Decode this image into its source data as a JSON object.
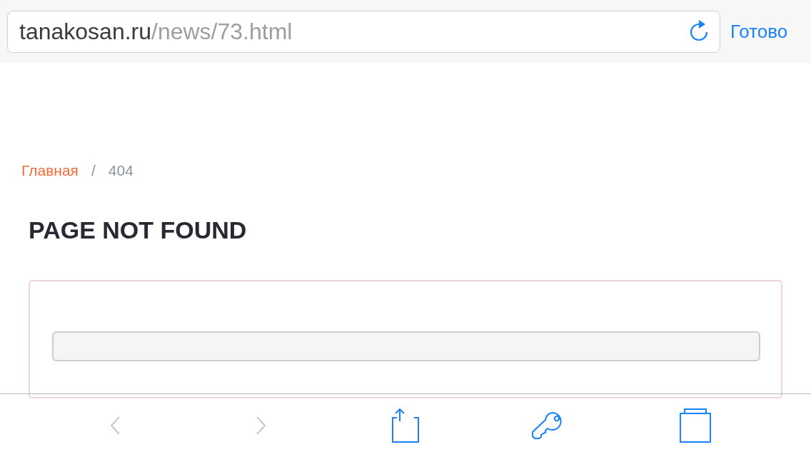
{
  "address_bar": {
    "host": "tanakosan.ru",
    "path": "/news/73.html",
    "done_label": "Готово"
  },
  "breadcrumb": [
    {
      "label": "Главная",
      "kind": "link"
    },
    {
      "label": "/",
      "kind": "separator"
    },
    {
      "label": "404",
      "kind": "current"
    }
  ],
  "heading": "PAGE NOT FOUND",
  "toolbar": [
    {
      "kind": "back",
      "disabled": true
    },
    {
      "kind": "forward",
      "disabled": true
    },
    {
      "kind": "share",
      "disabled": false
    },
    {
      "kind": "key",
      "disabled": false
    },
    {
      "kind": "tabs",
      "disabled": false
    }
  ]
}
